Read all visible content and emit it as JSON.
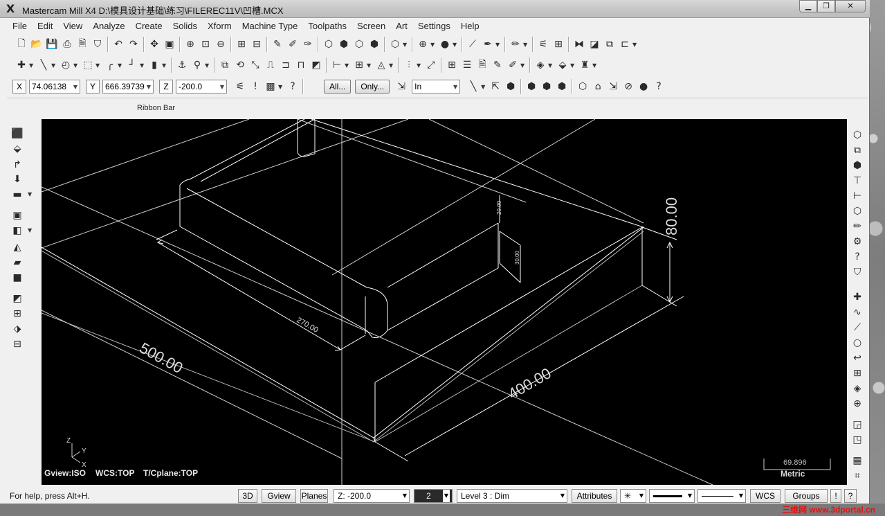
{
  "window": {
    "title": "Mastercam Mill X4  D:\\模具设计基础\\练习\\FILEREC11V\\凹槽.MCX",
    "minimize": "0",
    "maximize": "1",
    "close": "r"
  },
  "menu": [
    "File",
    "Edit",
    "View",
    "Analyze",
    "Create",
    "Solids",
    "Xform",
    "Machine Type",
    "Toolpaths",
    "Screen",
    "Art",
    "Settings",
    "Help"
  ],
  "coords": {
    "x_label": "X",
    "x_value": "74.06138",
    "y_label": "Y",
    "y_value": "666.39739",
    "z_label": "Z",
    "z_value": "-200.0",
    "all_button": "All...",
    "only_button": "Only...",
    "units": "In"
  },
  "ribbon": {
    "label": "Ribbon Bar"
  },
  "viewport": {
    "gview": "Gview:ISO",
    "wcs": "WCS:TOP",
    "tcplane": "T/Cplane:TOP",
    "scale_value": "69.896",
    "scale_unit": "Metric",
    "axis_z": "Z",
    "axis_y": "Y",
    "axis_x": "X",
    "dimensions": {
      "width": "500.00",
      "depth": "400.00",
      "height": "80.00",
      "pocket_length": "270.00",
      "small_1": "20.00",
      "small_2": "30.00"
    }
  },
  "status": {
    "help": "For help, press Alt+H.",
    "btn_3d": "3D",
    "btn_gview": "Gview",
    "btn_planes": "Planes",
    "z_field": "Z: -200.0",
    "color_value": "2",
    "level": "Level  3 : Dim",
    "attributes": "Attributes",
    "point_style": "✳",
    "wcs": "WCS",
    "groups": "Groups",
    "excl": "!",
    "help_q": "?"
  },
  "watermark": "三维网 www.3dportal.cn",
  "colors": {
    "viewport_bg": "#000000",
    "geometry": "#ffffff",
    "watermark": "#e81010"
  }
}
